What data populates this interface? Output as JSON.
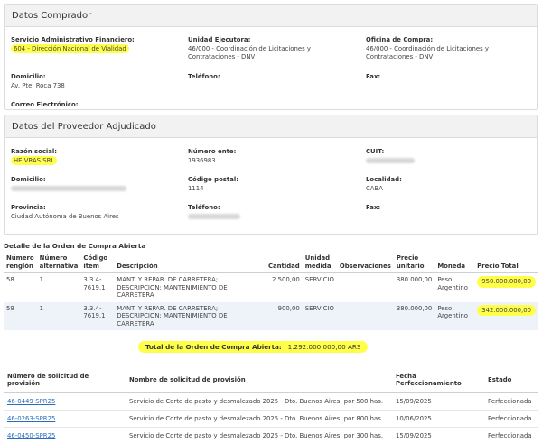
{
  "comprador": {
    "title": "Datos Comprador",
    "servicio_label": "Servicio Administrativo Financiero:",
    "servicio_value": "604 - Dirección Nacional de Vialidad",
    "unidad_label": "Unidad Ejecutora:",
    "unidad_value": "46/000 - Coordinación de Licitaciones y Contrataciones - DNV",
    "oficina_label": "Oficina de Compra:",
    "oficina_value": "46/000 - Coordinación de Licitaciones y Contrataciones - DNV",
    "domicilio_label": "Domicilio:",
    "domicilio_value": "Av. Pte. Roca 738",
    "telefono_label": "Teléfono:",
    "fax_label": "Fax:",
    "correo_label": "Correo Electrónico:"
  },
  "proveedor": {
    "title": "Datos del Proveedor Adjudicado",
    "razon_label": "Razón social:",
    "razon_value": "HE VRAS SRL",
    "numero_label": "Número ente:",
    "numero_value": "1936983",
    "cuit_label": "CUIT:",
    "domicilio_label": "Domicilio:",
    "cp_label": "Código postal:",
    "cp_value": "1114",
    "localidad_label": "Localidad:",
    "localidad_value": "CABA",
    "provincia_label": "Provincia:",
    "provincia_value": "Ciudad Autónoma de Buenos Aires",
    "telefono_label": "Teléfono:",
    "fax_label": "Fax:"
  },
  "detalle": {
    "title": "Detalle de la Orden de Compra Abierta",
    "headers": {
      "renglon": "Número renglón",
      "alternativa": "Número alternativa",
      "codigo": "Código ítem",
      "descripcion": "Descripción",
      "cantidad": "Cantidad",
      "unidad": "Unidad medida",
      "observaciones": "Observaciones",
      "precio_unitario": "Precio unitario",
      "moneda": "Moneda",
      "precio_total": "Precio Total"
    },
    "rows": [
      {
        "renglon": "58",
        "alternativa": "1",
        "codigo": "3.3.4-7619.1",
        "descripcion": "MANT. Y REPAR. DE CARRETERA; DESCRIPCION: MANTENIMIENTO DE CARRETERA",
        "cantidad": "2.500,00",
        "unidad": "SERVICIO",
        "observaciones": "",
        "precio_unitario": "380.000,00",
        "moneda": "Peso Argentino",
        "precio_total": "950.000.000,00"
      },
      {
        "renglon": "59",
        "alternativa": "1",
        "codigo": "3.3.4-7619.1",
        "descripcion": "MANT. Y REPAR. DE CARRETERA; DESCRIPCION: MANTENIMIENTO DE CARRETERA",
        "cantidad": "900,00",
        "unidad": "SERVICIO",
        "observaciones": "",
        "precio_unitario": "380.000,00",
        "moneda": "Peso Argentino",
        "precio_total": "342.000.000,00"
      }
    ]
  },
  "total": {
    "label": "Total de la Orden de Compra Abierta:",
    "value": "1.292.000.000,00 ARS"
  },
  "provision": {
    "headers": {
      "numero": "Número de solicitud de provisión",
      "nombre": "Nombre de solicitud de provisión",
      "fecha": "Fecha Perfeccionamiento",
      "estado": "Estado"
    },
    "rows": [
      {
        "numero": "46-0449-SPR25",
        "nombre": "Servicio de Corte de pasto y desmalezado 2025 - Dto. Buenos Aires, por 500 has.",
        "fecha": "15/09/2025",
        "estado": "Perfeccionada"
      },
      {
        "numero": "46-0263-SPR25",
        "nombre": "Servicio de Corte de pasto y desmalezado 2025 - Dto. Buenos Aires, por 800 has.",
        "fecha": "10/06/2025",
        "estado": "Perfeccionada"
      },
      {
        "numero": "46-0450-SPR25",
        "nombre": "Servicio de Corte de pasto y desmalezado 2025 - Dto. Buenos Aires, por 300 has.",
        "fecha": "15/09/2025",
        "estado": "Perfeccionada"
      }
    ]
  }
}
